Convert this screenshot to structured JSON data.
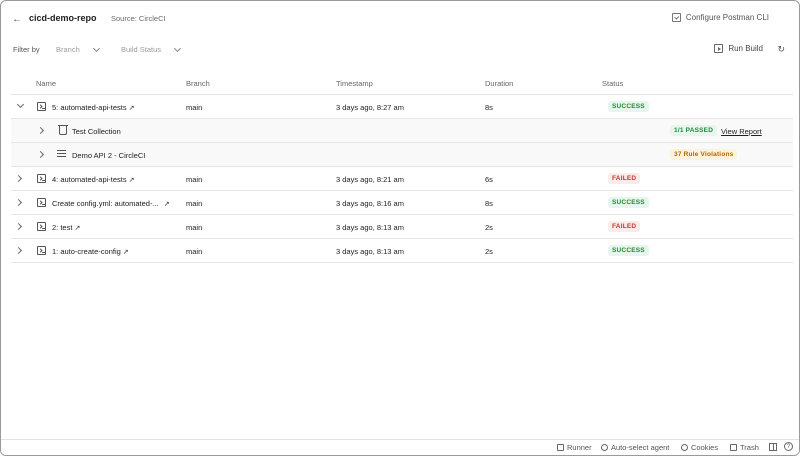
{
  "header": {
    "title": "cicd-demo-repo",
    "source": "Source: CircleCI",
    "configure_label": "Configure Postman CLI"
  },
  "filters": {
    "label": "Filter by",
    "branch_placeholder": "Branch",
    "status_placeholder": "Build Status",
    "run_build_label": "Run Build"
  },
  "table": {
    "columns": [
      "Name",
      "Branch",
      "Timestamp",
      "Duration",
      "Status"
    ],
    "rows": [
      {
        "name": "5: automated-api-tests",
        "branch": "main",
        "timestamp": "3 days ago, 8:27 am",
        "duration": "8s",
        "status": "SUCCESS"
      },
      {
        "name": "4: automated-api-tests",
        "branch": "main",
        "timestamp": "3 days ago, 8:21 am",
        "duration": "6s",
        "status": "FAILED"
      },
      {
        "name": "Create config.yml: automated-...",
        "branch": "main",
        "timestamp": "3 days ago, 8:16 am",
        "duration": "8s",
        "status": "SUCCESS"
      },
      {
        "name": "2: test",
        "branch": "main",
        "timestamp": "3 days ago, 8:13 am",
        "duration": "2s",
        "status": "FAILED"
      },
      {
        "name": "1: auto-create-config",
        "branch": "main",
        "timestamp": "3 days ago, 8:13 am",
        "duration": "2s",
        "status": "SUCCESS"
      }
    ],
    "subrows": [
      {
        "name": "Test Collection",
        "badge": "1/1 PASSED",
        "link": "View Report"
      },
      {
        "name": "Demo API 2 - CircleCI",
        "badge": "37 Rule Violations"
      }
    ]
  },
  "statusbar": {
    "runner": "Runner",
    "agent": "Auto-select agent",
    "cookies": "Cookies",
    "trash": "Trash"
  },
  "colors": {
    "success": "#1f8a3a",
    "failed": "#c0392b",
    "violation": "#a86b00"
  }
}
